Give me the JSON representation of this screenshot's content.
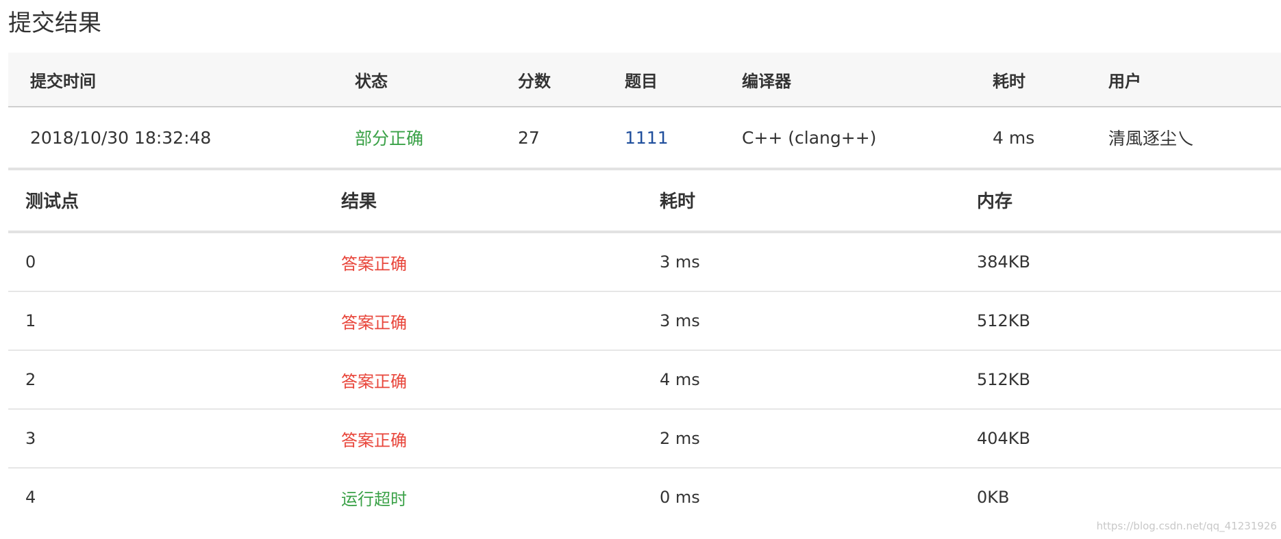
{
  "page": {
    "title": "提交结果"
  },
  "summary": {
    "headers": {
      "submit_time": "提交时间",
      "status": "状态",
      "score": "分数",
      "problem": "题目",
      "compiler": "编译器",
      "time_cost": "耗时",
      "user": "用户"
    },
    "row": {
      "submit_time": "2018/10/30 18:32:48",
      "status": "部分正确",
      "score": "27",
      "problem": "1111",
      "compiler": "C++ (clang++)",
      "time_cost": "4 ms",
      "user": "清風逐尘乀"
    }
  },
  "testpoints": {
    "headers": {
      "id": "测试点",
      "result": "结果",
      "time": "耗时",
      "memory": "内存"
    },
    "rows": [
      {
        "id": "0",
        "result": "答案正确",
        "time": "3 ms",
        "memory": "384KB"
      },
      {
        "id": "1",
        "result": "答案正确",
        "time": "3 ms",
        "memory": "512KB"
      },
      {
        "id": "2",
        "result": "答案正确",
        "time": "4 ms",
        "memory": "512KB"
      },
      {
        "id": "3",
        "result": "答案正确",
        "time": "2 ms",
        "memory": "404KB"
      },
      {
        "id": "4",
        "result": "运行超时",
        "time": "0 ms",
        "memory": "0KB"
      }
    ]
  },
  "colors": {
    "accepted": "#e8463b",
    "partial_or_tle": "#3aa147",
    "link": "#1f4e9c",
    "header_bg": "#f7f7f7"
  },
  "watermark": "https://blog.csdn.net/qq_41231926"
}
